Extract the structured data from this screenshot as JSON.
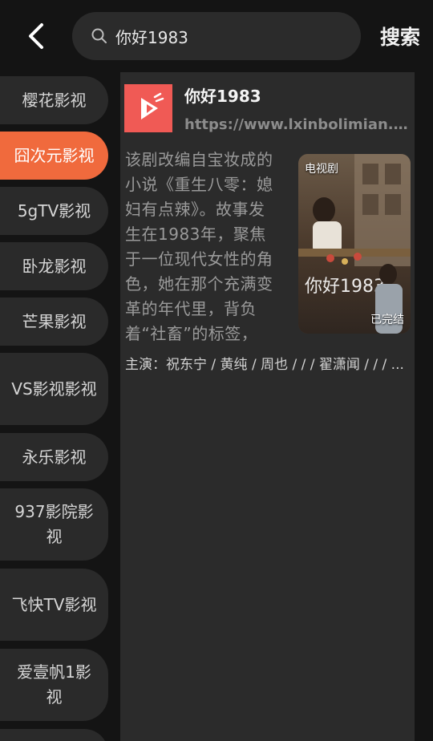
{
  "header": {
    "search_value": "你好1983",
    "search_button_label": "搜索"
  },
  "sidebar": {
    "items": [
      {
        "label": "樱花影视",
        "active": false
      },
      {
        "label": "囧次元影视",
        "active": true
      },
      {
        "label": "5gTV影视",
        "active": false
      },
      {
        "label": "卧龙影视",
        "active": false
      },
      {
        "label": "芒果影视",
        "active": false
      },
      {
        "label": "VS影视影视",
        "active": false
      },
      {
        "label": "永乐影视",
        "active": false
      },
      {
        "label": "937影院影视",
        "active": false
      },
      {
        "label": "飞快TV影视",
        "active": false
      },
      {
        "label": "爱壹帆1影视",
        "active": false
      }
    ]
  },
  "result": {
    "title": "你好1983",
    "url": "https://www.lxinbolimian.com",
    "description": "该剧改编自宝妆成的小说《重生八零：媳妇有点辣》。故事发生在1983年，聚焦于一位现代女性的角色，她在那个充满变革的年代里，背负着“社畜”的标签，却...",
    "poster_type_badge": "电视剧",
    "poster_status_badge": "已完结",
    "cast": "主演：祝东宁 / 黄纯 / 周也 / / / 翟潇闻 / / / ..."
  },
  "colors": {
    "accent": "#f06a3d",
    "logo_bg": "#f05a55",
    "background": "#141414",
    "panel": "#2b2b2b"
  }
}
